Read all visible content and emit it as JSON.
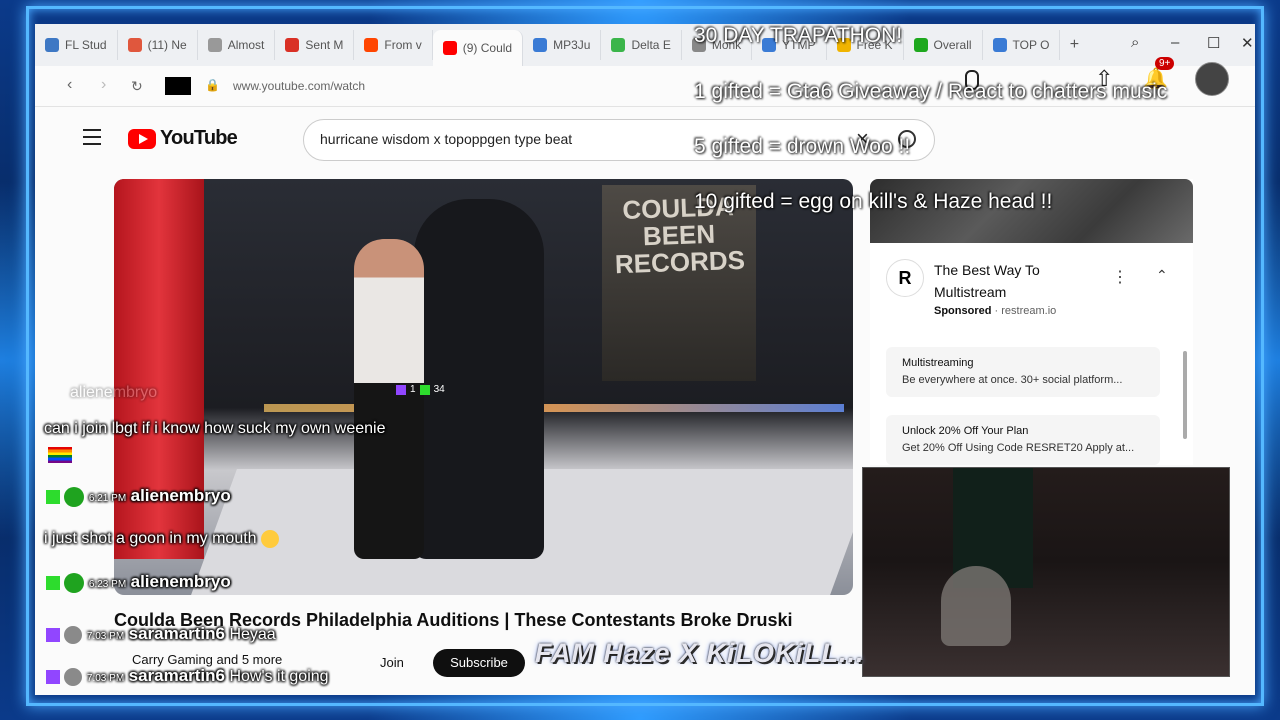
{
  "browser": {
    "tabs": [
      {
        "label": "FL Stud",
        "color": "#3e78c4"
      },
      {
        "label": "(11) Ne",
        "color": "#e0573d"
      },
      {
        "label": "Almost",
        "color": "#999999"
      },
      {
        "label": "Sent M",
        "color": "#d93025"
      },
      {
        "label": "From v",
        "color": "#ff4500"
      },
      {
        "label": "(9) Could",
        "color": "#ff0000"
      },
      {
        "label": "MP3Ju",
        "color": "#3a7bd5"
      },
      {
        "label": "Delta E",
        "color": "#3ab54a"
      },
      {
        "label": "Monk",
        "color": "#888888"
      },
      {
        "label": "YTMP",
        "color": "#3a7bd5"
      },
      {
        "label": "Free K",
        "color": "#f0b400"
      },
      {
        "label": "Overall",
        "color": "#1ea81e"
      },
      {
        "label": "TOP O",
        "color": "#3a7bd5"
      }
    ],
    "url": "www.youtube.com/watch"
  },
  "youtube": {
    "logo_text": "YouTube",
    "search_value": "hurricane wisdom x topoppgen type beat",
    "notification_count": "9+",
    "video_title": "Coulda Been Records Philadelphia Auditions | These Contestants Broke Druski",
    "channel_subs": "Carry Gaming and 5 more",
    "join_label": "Join",
    "subscribe_label": "Subscribe",
    "progress": 0.0,
    "video_banner": "COULDA BEEN RECORDS",
    "video_counter": {
      "twitch": "1",
      "kick": "34"
    }
  },
  "ad": {
    "logo_letter": "R",
    "title": "The Best Way To Multistream",
    "sponsored": "Sponsored",
    "domain": "restream.io",
    "items": [
      {
        "title": "Multistreaming",
        "desc": "Be everywhere at once. 30+ social platform..."
      },
      {
        "title": "Unlock 20% Off Your Plan",
        "desc": "Get 20% Off Using Code RESRET20 Apply at..."
      }
    ]
  },
  "overlay": {
    "line1": "30 DAY TRAPATHON!",
    "line2": "1 gifted = Gta6 Giveaway / React to chatters music",
    "line3": "5 gifted = drown Woo  !!",
    "line4": "10 gifted = egg on kill's & Haze head  !!",
    "logo": "FAM Haze X KiLOKiLL..."
  },
  "chat": {
    "faded_user": "alienembryo",
    "msg1": "can i join lbgt if i know how suck my own weenie",
    "time2": "6:21 PM",
    "user2": "alienembryo",
    "msg2": "i just shot a goon in my mouth",
    "time3": "6:23 PM",
    "user3": "alienembryo",
    "time4": "7:03 PM",
    "user4": "saramartin6",
    "msg4": "Heyaa",
    "time5": "7:03 PM",
    "user5": "saramartin6",
    "msg5": "How's it going"
  }
}
